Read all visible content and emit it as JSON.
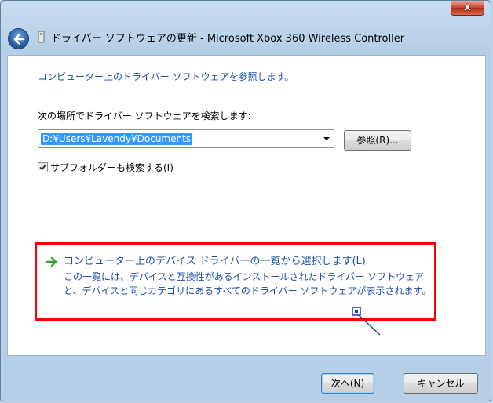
{
  "window": {
    "title": "ドライバー ソフトウェアの更新 - Microsoft Xbox 360 Wireless Controller",
    "close_glyph": "x"
  },
  "content": {
    "instruction": "コンピューター上のドライバー ソフトウェアを参照します。",
    "search_label": "次の場所でドライバー ソフトウェアを検索します:",
    "path_value": "D:¥Users¥Lavendy¥Documents",
    "browse_label": "参照(R)...",
    "include_subfolders": {
      "label": "サブフォルダーも検索する(I)",
      "checked": true
    },
    "pick_option": {
      "title": "コンピューター上のデバイス ドライバーの一覧から選択します(L)",
      "description": "この一覧には、デバイスと互換性があるインストールされたドライバー ソフトウェアと、デバイスと同じカテゴリにあるすべてのドライバー ソフトウェアが表示されます。"
    }
  },
  "footer": {
    "next_label": "次へ(N)",
    "cancel_label": "キャンセル"
  },
  "colors": {
    "link_blue": "#1e50a2",
    "highlight_red": "#ff0000",
    "selection_blue": "#3399ff"
  }
}
